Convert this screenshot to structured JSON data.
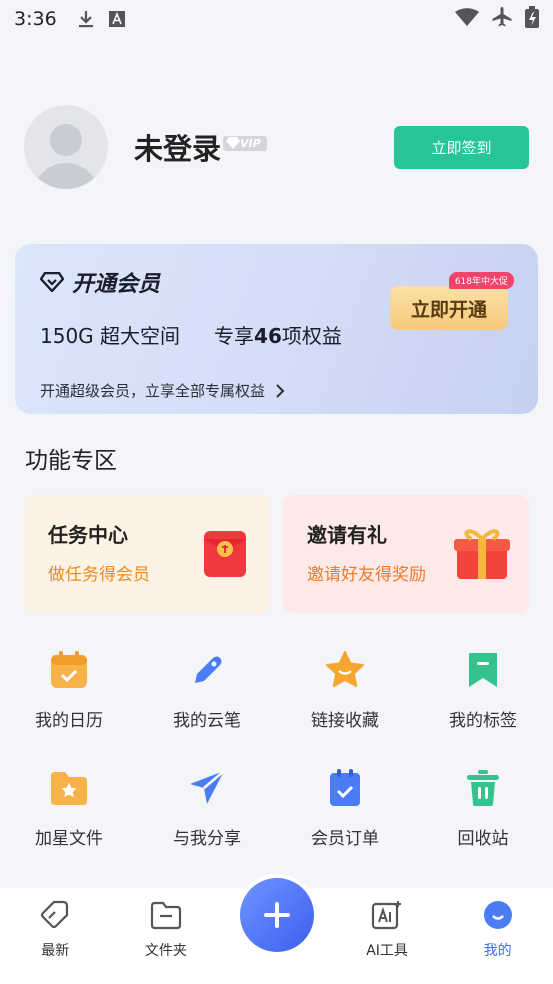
{
  "status_bar": {
    "time": "3:36"
  },
  "profile": {
    "name": "未登录",
    "vip_badge": "VIP",
    "checkin_label": "立即签到"
  },
  "member_card": {
    "title": "开通会员",
    "benefit_space": "150G 超大空间",
    "benefit_rights_prefix": "专享",
    "benefit_rights_count": "46",
    "benefit_rights_suffix": "项权益",
    "link_text": "开通超级会员，立享全部专属权益",
    "open_label": "立即开通",
    "promo_badge": "618年中大促"
  },
  "features": {
    "section_title": "功能专区",
    "task": {
      "title": "任务中心",
      "subtitle": "做任务得会员"
    },
    "invite": {
      "title": "邀请有礼",
      "subtitle": "邀请好友得奖励"
    }
  },
  "grid": {
    "items": [
      {
        "label": "我的日历",
        "icon": "calendar-icon"
      },
      {
        "label": "我的云笔",
        "icon": "pen-icon"
      },
      {
        "label": "链接收藏",
        "icon": "star-icon"
      },
      {
        "label": "我的标签",
        "icon": "bookmark-icon"
      },
      {
        "label": "加星文件",
        "icon": "starred-folder-icon"
      },
      {
        "label": "与我分享",
        "icon": "send-icon"
      },
      {
        "label": "会员订单",
        "icon": "order-clipboard-icon"
      },
      {
        "label": "回收站",
        "icon": "trash-icon"
      }
    ]
  },
  "tabbar": {
    "tabs": [
      {
        "label": "最新",
        "icon": "tag-icon"
      },
      {
        "label": "文件夹",
        "icon": "folder-icon"
      },
      {
        "label": "AI工具",
        "icon": "ai-tool-icon"
      },
      {
        "label": "我的",
        "icon": "profile-smile-icon"
      }
    ],
    "active": "我的"
  },
  "colors": {
    "accent": "#3d6cf1",
    "checkin": "#27c59a",
    "task_text": "#f08a1f",
    "promo": "#f2436a"
  }
}
